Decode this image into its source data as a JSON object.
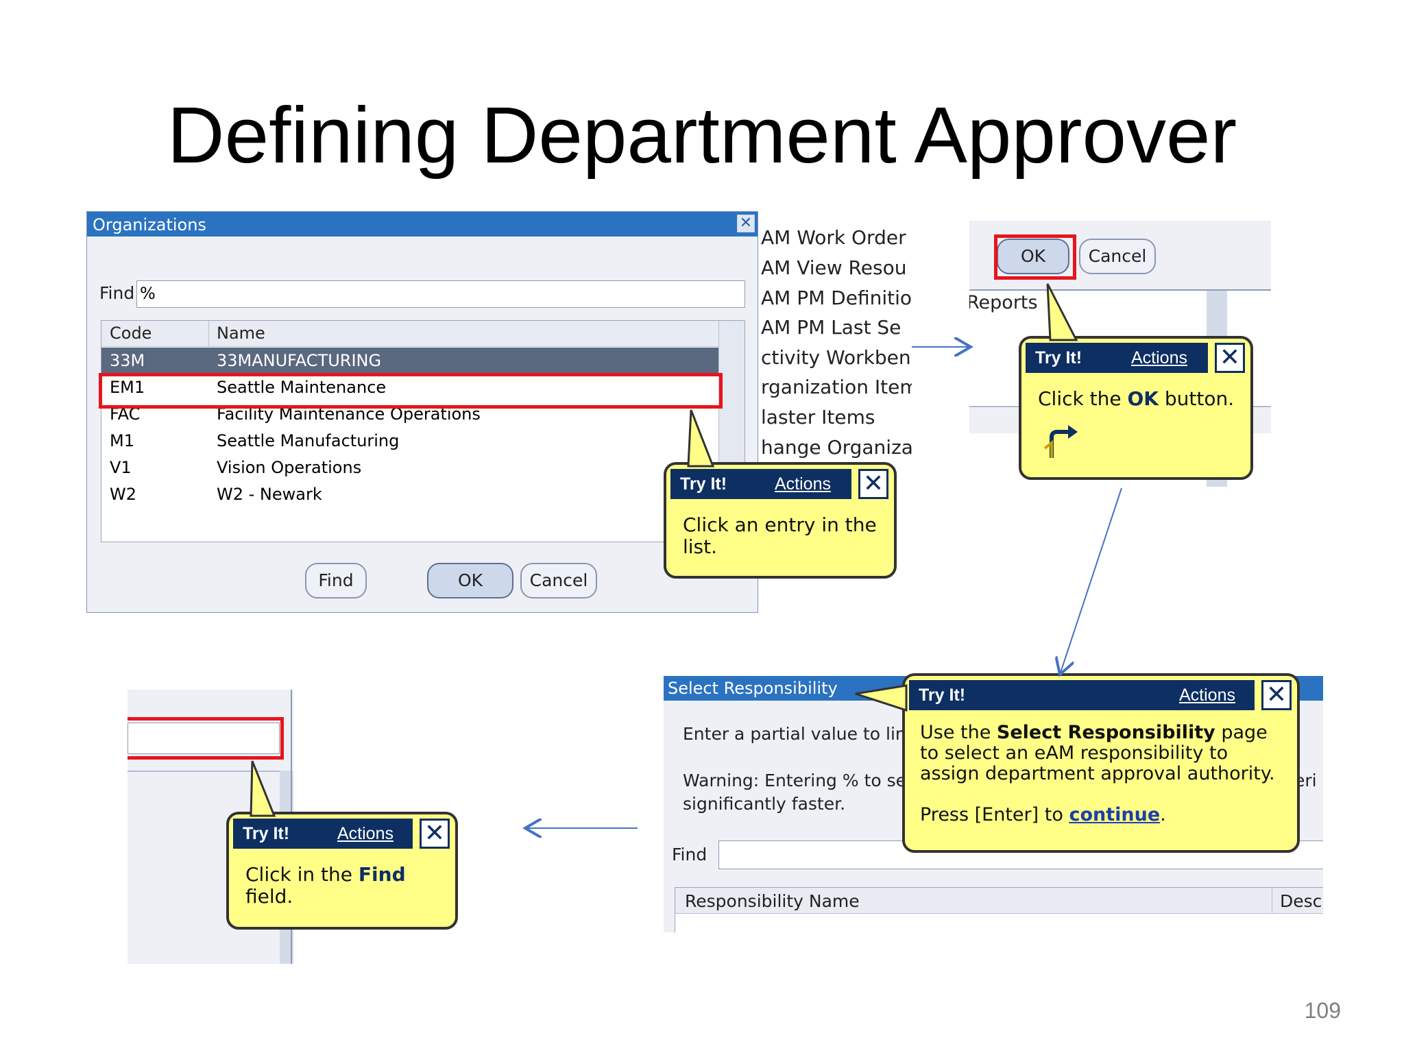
{
  "slide": {
    "title": "Defining Department Approver",
    "page_number": "109"
  },
  "org_dialog": {
    "title": "Organizations",
    "find_label": "Find",
    "find_value": "%",
    "columns": [
      "Code",
      "Name"
    ],
    "rows": [
      {
        "code": "33M",
        "name": "33MANUFACTURING",
        "selected": true
      },
      {
        "code": "EM1",
        "name": "Seattle Maintenance",
        "selected": false
      },
      {
        "code": "FAC",
        "name": "Facility Maintenance Operations",
        "selected": false
      },
      {
        "code": "M1",
        "name": "Seattle Manufacturing",
        "selected": false
      },
      {
        "code": "V1",
        "name": "Vision Operations",
        "selected": false
      },
      {
        "code": "W2",
        "name": "W2 - Newark",
        "selected": false
      }
    ],
    "buttons": {
      "find": "Find",
      "ok": "OK",
      "cancel": "Cancel"
    },
    "close_glyph": "✕"
  },
  "side_menu": {
    "items": [
      "AM Work Order",
      "AM View Resou",
      "AM PM Definitio",
      "AM PM Last Se",
      "ctivity Workbenc",
      "rganization Item",
      "laster Items",
      "hange Organizat"
    ]
  },
  "okcancel_shot": {
    "ok": "OK",
    "cancel": "Cancel",
    "reports_text": "Reports"
  },
  "select_resp": {
    "title": "Select Responsibility",
    "instruction": "Enter a partial value to limit",
    "warning_line1": "Warning: Entering % to see",
    "warning_line2": "significantly faster.",
    "find_label": "Find",
    "col_name": "Responsibility Name",
    "col_desc": "Desc",
    "side_fragment": "eri"
  },
  "bubbles": {
    "header_try": "Try It!",
    "header_actions": "Actions",
    "close_glyph": "✕",
    "list_entry": {
      "text": "Click an entry in the list."
    },
    "ok_button": {
      "text_before": "Click the ",
      "keyword": "OK",
      "text_after": " button.",
      "icon": "turn-right-arrow-icon"
    },
    "select_resp": {
      "line_before": "Use the ",
      "keyword": "Select Responsibility",
      "line_after": " page to select an eAM responsibility to assign department approval authority.",
      "press_before": "Press [Enter] to ",
      "press_link": "continue",
      "press_after": "."
    },
    "find_field": {
      "text_before": "Click in the ",
      "keyword": "Find",
      "text_after": " field."
    }
  },
  "colors": {
    "titlebar_blue": "#2b73c0",
    "bubble_yellow": "#ffff88",
    "bubble_header_navy": "#0d2f62",
    "highlight_red": "#e8141c",
    "selected_row": "#5a6880",
    "arrow_blue": "#4472c4"
  }
}
